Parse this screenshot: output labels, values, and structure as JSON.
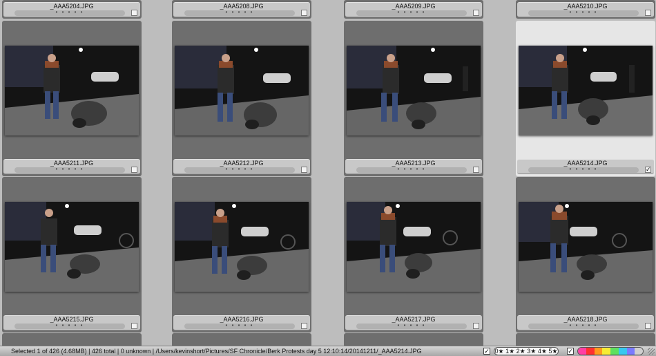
{
  "top_row": [
    {
      "filename": "_AAA5204.JPG",
      "dots": "• • • • •"
    },
    {
      "filename": "_AAA5208.JPG",
      "dots": "• • • • •"
    },
    {
      "filename": "_AAA5209.JPG",
      "dots": "• • • • •"
    },
    {
      "filename": "_AAA5210.JPG",
      "dots": "• • • • •"
    }
  ],
  "row1": [
    {
      "filename": "_AAA5211.JPG",
      "dots": "• • • • •",
      "checked": ""
    },
    {
      "filename": "_AAA5212.JPG",
      "dots": "• • • • •",
      "checked": ""
    },
    {
      "filename": "_AAA5213.JPG",
      "dots": "• • • • •",
      "checked": ""
    },
    {
      "filename": "_AAA5214.JPG",
      "dots": "• • • • •",
      "checked": "✓"
    }
  ],
  "row2": [
    {
      "filename": "_AAA5215.JPG",
      "dots": "• • • • •",
      "checked": ""
    },
    {
      "filename": "_AAA5216.JPG",
      "dots": "• • • • •",
      "checked": ""
    },
    {
      "filename": "_AAA5217.JPG",
      "dots": "• • • • •",
      "checked": ""
    },
    {
      "filename": "_AAA5218.JPG",
      "dots": "• • • • •",
      "checked": ""
    }
  ],
  "status": {
    "text": "Selected 1 of 426 (4.68MB) | 426 total | 0 unknown | /Users/kevinshort/Pictures/SF Chronicle/Berk Protests day 5 12:10:14/20141211/_AAA5214.JPG",
    "rating_filter": "0★ 1★ 2★ 3★ 4★ 5★",
    "check1": "✓",
    "check2": "✓",
    "color_labels": [
      "#ff3fa4",
      "#ff3030",
      "#ff9a1e",
      "#f6ec35",
      "#5fe05f",
      "#38c8f0",
      "#7a7aff",
      "#cfcfcf"
    ]
  },
  "icons": {
    "thumbnail": "photo-thumbnail",
    "checkbox": "checkbox-icon",
    "grip": "resize-grip-icon"
  }
}
